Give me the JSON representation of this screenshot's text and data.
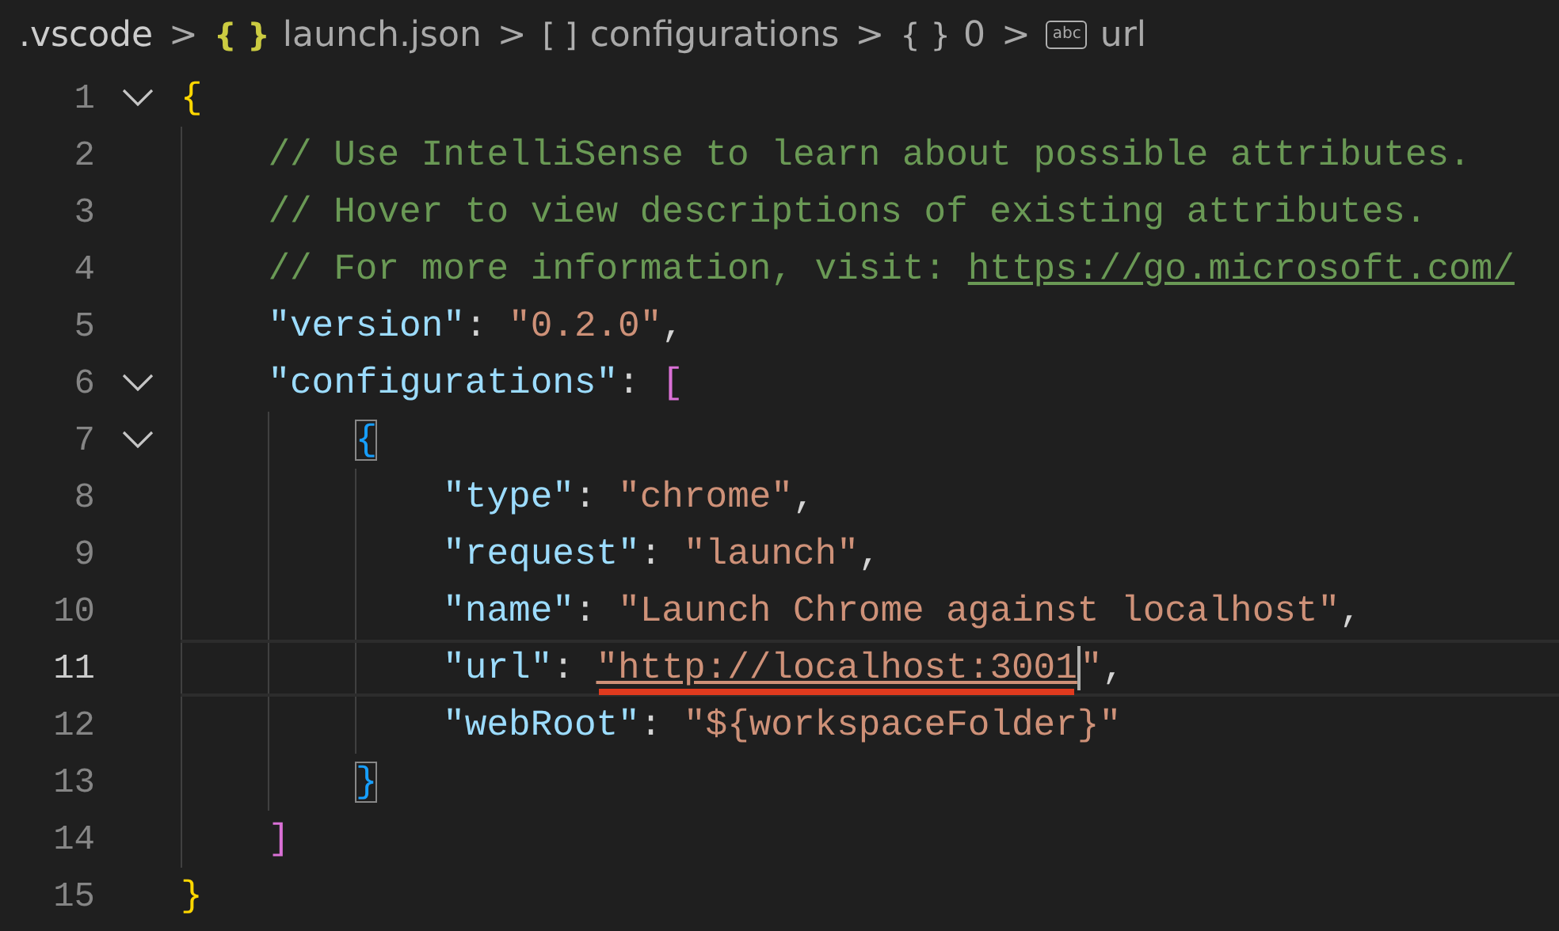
{
  "breadcrumbs": [
    {
      "kind": "folder",
      "label": ".vscode"
    },
    {
      "kind": "file",
      "icon": "{ }",
      "label": "launch.json"
    },
    {
      "kind": "array",
      "icon": "[ ]",
      "label": "configurations"
    },
    {
      "kind": "object",
      "icon": "{ }",
      "label": "0"
    },
    {
      "kind": "string",
      "icon": "abc",
      "label": "url"
    }
  ],
  "separator": ">",
  "lines": [
    {
      "number": "1",
      "expanded": true,
      "current": false,
      "tokens": [
        {
          "kind": "bracket1",
          "t": "{"
        }
      ],
      "children": [
        {
          "number": "2",
          "current": false,
          "tokens": [
            {
              "kind": "comment",
              "t": "// Use IntelliSense to learn about possible attributes."
            }
          ]
        },
        {
          "number": "3",
          "current": false,
          "tokens": [
            {
              "kind": "comment",
              "t": "// Hover to view descriptions of existing attributes."
            }
          ]
        },
        {
          "number": "4",
          "current": false,
          "tokens": [
            {
              "kind": "comment",
              "t": "// For more information, visit: "
            },
            {
              "kind": "link",
              "t": "https://go.microsoft.com/"
            }
          ]
        },
        {
          "number": "5",
          "current": false,
          "tokens": [
            {
              "kind": "key",
              "t": "\"version\""
            },
            {
              "kind": "punct",
              "t": ": "
            },
            {
              "kind": "string",
              "t": "\"0.2.0\""
            },
            {
              "kind": "punct",
              "t": ","
            }
          ]
        },
        {
          "number": "6",
          "expanded": true,
          "current": false,
          "tokens": [
            {
              "kind": "key",
              "t": "\"configurations\""
            },
            {
              "kind": "punct",
              "t": ": "
            },
            {
              "kind": "bracket2",
              "t": "["
            }
          ],
          "children": [
            {
              "number": "7",
              "expanded": true,
              "current": false,
              "tokens": [
                {
                  "kind": "bracket3",
                  "t": "{",
                  "matched": true
                }
              ],
              "children": [
                {
                  "number": "8",
                  "current": false,
                  "tokens": [
                    {
                      "kind": "key",
                      "t": "\"type\""
                    },
                    {
                      "kind": "punct",
                      "t": ": "
                    },
                    {
                      "kind": "string",
                      "t": "\"chrome\""
                    },
                    {
                      "kind": "punct",
                      "t": ","
                    }
                  ]
                },
                {
                  "number": "9",
                  "current": false,
                  "tokens": [
                    {
                      "kind": "key",
                      "t": "\"request\""
                    },
                    {
                      "kind": "punct",
                      "t": ": "
                    },
                    {
                      "kind": "string",
                      "t": "\"launch\""
                    },
                    {
                      "kind": "punct",
                      "t": ","
                    }
                  ]
                },
                {
                  "number": "10",
                  "current": false,
                  "tokens": [
                    {
                      "kind": "key",
                      "t": "\"name\""
                    },
                    {
                      "kind": "punct",
                      "t": ": "
                    },
                    {
                      "kind": "string",
                      "t": "\"Launch Chrome against localhost\""
                    },
                    {
                      "kind": "punct",
                      "t": ","
                    }
                  ]
                },
                {
                  "number": "11",
                  "current": true,
                  "tokens": [
                    {
                      "kind": "key",
                      "t": "\"url\""
                    },
                    {
                      "kind": "punct",
                      "t": ": "
                    },
                    {
                      "kind": "string",
                      "t": "\"http://localhost:3001",
                      "underlined": true
                    },
                    {
                      "kind": "cursor"
                    },
                    {
                      "kind": "string",
                      "t": "\""
                    },
                    {
                      "kind": "punct",
                      "t": ","
                    }
                  ]
                },
                {
                  "number": "12",
                  "current": false,
                  "tokens": [
                    {
                      "kind": "key",
                      "t": "\"webRoot\""
                    },
                    {
                      "kind": "punct",
                      "t": ": "
                    },
                    {
                      "kind": "string",
                      "t": "\"${workspaceFolder}\""
                    }
                  ]
                }
              ]
            },
            {
              "number": "13",
              "current": false,
              "tokens": [
                {
                  "kind": "bracket3",
                  "t": "}",
                  "matched": true
                }
              ]
            }
          ]
        },
        {
          "number": "14",
          "current": false,
          "tokens": [
            {
              "kind": "bracket2",
              "t": "]"
            }
          ]
        }
      ]
    },
    {
      "number": "15",
      "current": false,
      "tokens": [
        {
          "kind": "bracket1",
          "t": "}"
        }
      ]
    }
  ]
}
